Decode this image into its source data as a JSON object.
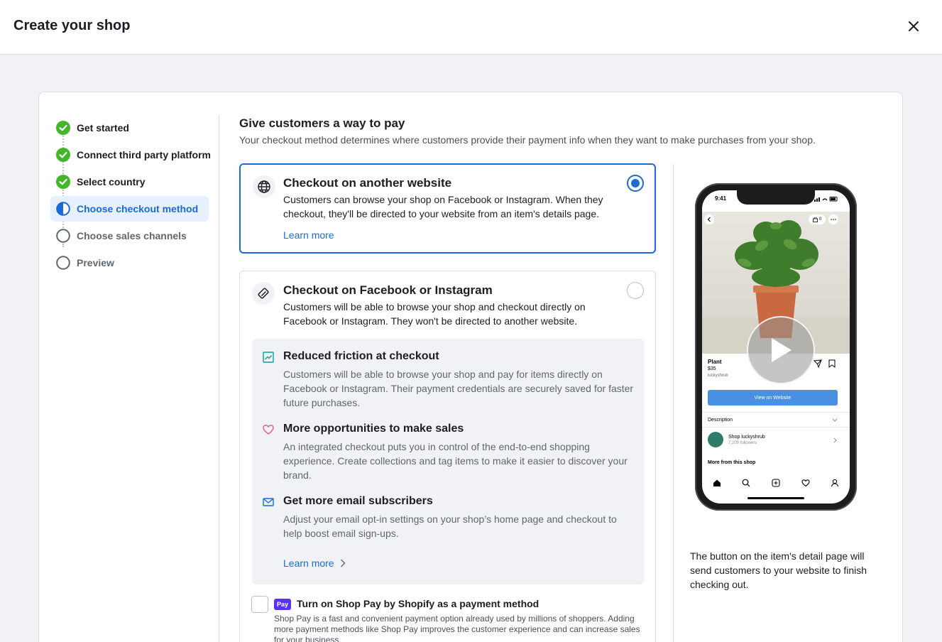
{
  "header": {
    "title": "Create your shop"
  },
  "stepper": {
    "steps": [
      {
        "label": "Get started",
        "state": "done"
      },
      {
        "label": "Connect third party platform",
        "state": "done"
      },
      {
        "label": "Select country",
        "state": "done"
      },
      {
        "label": "Choose checkout method",
        "state": "active"
      },
      {
        "label": "Choose sales channels",
        "state": "todo"
      },
      {
        "label": "Preview",
        "state": "todo"
      }
    ]
  },
  "main": {
    "title": "Give customers a way to pay",
    "subtitle": "Your checkout method determines where customers provide their payment info when they want to make purchases from your shop."
  },
  "options": [
    {
      "title": "Checkout on another website",
      "description": "Customers can browse your shop on Facebook or Instagram. When they checkout, they'll be directed to your website from an item's details page.",
      "learn_more": "Learn more",
      "selected": true,
      "icon": "globe-icon"
    },
    {
      "title": "Checkout on Facebook or Instagram",
      "description": "Customers will be able to browse your shop and checkout directly on Facebook or Instagram. They won't be directed to another website.",
      "selected": false,
      "icon": "card-icon",
      "benefits": [
        {
          "title": "Reduced friction at checkout",
          "description": "Customers will be able to browse your shop and pay for items directly on Facebook or Instagram. Their payment credentials are securely saved for faster future purchases.",
          "icon": "trend-up-icon"
        },
        {
          "title": "More opportunities to make sales",
          "description": "An integrated checkout puts you in control of the end-to-end shopping experience. Create collections and tag items to make it easier to discover your brand.",
          "icon": "heart-icon"
        },
        {
          "title": "Get more email subscribers",
          "description": "Adjust your email opt-in settings on your shop’s home page and checkout to help boost email sign-ups.",
          "icon": "mail-icon"
        }
      ],
      "learn_more": "Learn more"
    }
  ],
  "shop_pay": {
    "badge": "Pay",
    "title": "Turn on Shop Pay by Shopify as a payment method",
    "description": "Shop Pay is a fast and convenient payment option already used by millions of shoppers. Adding more payment methods like Shop Pay improves the customer experience and can increase sales for your business.",
    "checked": false
  },
  "preview": {
    "caption": "The button on the item's detail page will send customers to your website to finish checking out.",
    "phone": {
      "time": "9:41",
      "cart_count": "0",
      "product_name": "Plant",
      "price": "$35",
      "seller_handle": "luckyshrub",
      "cta": "View on Website",
      "description_label": "Description",
      "shop_name": "Shop luckyshrub",
      "followers": "7,209 followers",
      "more_label": "More from this shop"
    }
  },
  "colors": {
    "accent": "#1b6bd6",
    "success": "#42b72a",
    "shop_pay": "#5a31f4"
  }
}
